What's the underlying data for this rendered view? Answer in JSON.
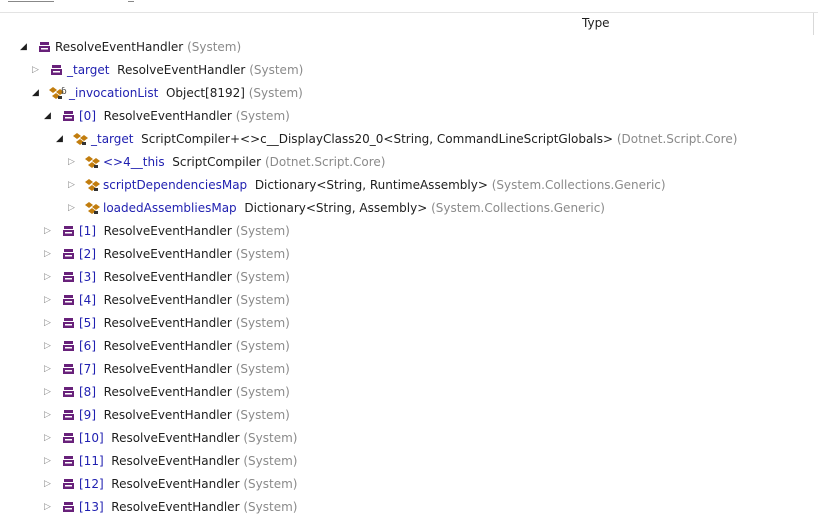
{
  "columns": {
    "type_header": "Type"
  },
  "rows": [
    {
      "indent": 0,
      "expander": "open",
      "icon": "class-icon",
      "name": "ResolveEventHandler",
      "value": "",
      "type": "(System)",
      "nameColor": "value"
    },
    {
      "indent": 1,
      "expander": "closed",
      "icon": "class-icon",
      "name": "_target",
      "value": "ResolveEventHandler",
      "type": "(System)"
    },
    {
      "indent": 1,
      "expander": "open",
      "icon": "field-private-icon",
      "lock": "ɓ",
      "name": "_invocationList",
      "value": "Object[8192]",
      "type": "(System)"
    },
    {
      "indent": 2,
      "expander": "open",
      "icon": "class-icon",
      "name": "[0]",
      "value": "ResolveEventHandler",
      "type": "(System)"
    },
    {
      "indent": 3,
      "expander": "open",
      "icon": "field-icon",
      "name": "_target",
      "value": "ScriptCompiler+<>c__DisplayClass20_0<String, CommandLineScriptGlobals>",
      "type": "(Dotnet.Script.Core)"
    },
    {
      "indent": 4,
      "expander": "closed",
      "icon": "field-icon",
      "name": "<>4__this",
      "value": "ScriptCompiler",
      "type": "(Dotnet.Script.Core)"
    },
    {
      "indent": 4,
      "expander": "closed",
      "icon": "field-icon",
      "name": "scriptDependenciesMap",
      "value": "Dictionary<String, RuntimeAssembly>",
      "type": "(System.Collections.Generic)"
    },
    {
      "indent": 4,
      "expander": "closed",
      "icon": "field-icon",
      "name": "loadedAssembliesMap",
      "value": "Dictionary<String, Assembly>",
      "type": "(System.Collections.Generic)"
    },
    {
      "indent": 2,
      "expander": "closed",
      "icon": "class-icon",
      "name": "[1]",
      "value": "ResolveEventHandler",
      "type": "(System)"
    },
    {
      "indent": 2,
      "expander": "closed",
      "icon": "class-icon",
      "name": "[2]",
      "value": "ResolveEventHandler",
      "type": "(System)"
    },
    {
      "indent": 2,
      "expander": "closed",
      "icon": "class-icon",
      "name": "[3]",
      "value": "ResolveEventHandler",
      "type": "(System)"
    },
    {
      "indent": 2,
      "expander": "closed",
      "icon": "class-icon",
      "name": "[4]",
      "value": "ResolveEventHandler",
      "type": "(System)"
    },
    {
      "indent": 2,
      "expander": "closed",
      "icon": "class-icon",
      "name": "[5]",
      "value": "ResolveEventHandler",
      "type": "(System)"
    },
    {
      "indent": 2,
      "expander": "closed",
      "icon": "class-icon",
      "name": "[6]",
      "value": "ResolveEventHandler",
      "type": "(System)"
    },
    {
      "indent": 2,
      "expander": "closed",
      "icon": "class-icon",
      "name": "[7]",
      "value": "ResolveEventHandler",
      "type": "(System)"
    },
    {
      "indent": 2,
      "expander": "closed",
      "icon": "class-icon",
      "name": "[8]",
      "value": "ResolveEventHandler",
      "type": "(System)"
    },
    {
      "indent": 2,
      "expander": "closed",
      "icon": "class-icon",
      "name": "[9]",
      "value": "ResolveEventHandler",
      "type": "(System)"
    },
    {
      "indent": 2,
      "expander": "closed",
      "icon": "class-icon",
      "name": "[10]",
      "value": "ResolveEventHandler",
      "type": "(System)"
    },
    {
      "indent": 2,
      "expander": "closed",
      "icon": "class-icon",
      "name": "[11]",
      "value": "ResolveEventHandler",
      "type": "(System)"
    },
    {
      "indent": 2,
      "expander": "closed",
      "icon": "class-icon",
      "name": "[12]",
      "value": "ResolveEventHandler",
      "type": "(System)"
    },
    {
      "indent": 2,
      "expander": "closed",
      "icon": "class-icon",
      "name": "[13]",
      "value": "ResolveEventHandler",
      "type": "(System)"
    }
  ],
  "colors": {
    "name": "#1f1fb0",
    "value": "#1e1e1e",
    "type": "#8a8a8a",
    "class_icon": "#68217a",
    "field_icon": "#c27d0e"
  }
}
